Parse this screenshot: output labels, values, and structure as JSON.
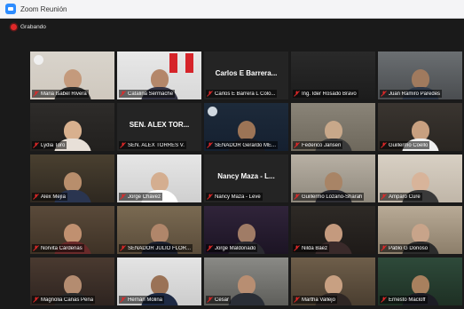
{
  "window": {
    "title": "Zoom Reunión"
  },
  "recording": {
    "label": "Grabando"
  },
  "colors": {
    "record": "#e02828",
    "accent": "#2d8cff",
    "active_border": "#c9d846",
    "mic_muted": "#e02828"
  },
  "participants": [
    {
      "name": "Maria Isabel Rivera"
    },
    {
      "name": "Catalina Sermache"
    },
    {
      "name": "Carlos E Barrera L Colo...",
      "display": "Carlos E Barrera..."
    },
    {
      "name": "Ing. Ider Rosado Bravo"
    },
    {
      "name": "Juan Ramiro Paredes"
    },
    {
      "name": "Lydia Toro"
    },
    {
      "name": "SEN. ALEX TORRES V.",
      "display": "SEN. ALEX TOR..."
    },
    {
      "name": "SENADOR Gerardo ME..."
    },
    {
      "name": "Federico Jansen"
    },
    {
      "name": "Guillermo Coello"
    },
    {
      "name": "Alex Mejía"
    },
    {
      "name": "Jorge Chavez"
    },
    {
      "name": "Nancy Maza - Leve",
      "display": "Nancy Maza - L..."
    },
    {
      "name": "Guillermo Lozano-Sharah"
    },
    {
      "name": "Amparo Cure"
    },
    {
      "name": "Norvita Cárdenas"
    },
    {
      "name": "SENADOR JULIO FLOR..."
    },
    {
      "name": "Jorge Maldonado"
    },
    {
      "name": "Nilda Báez"
    },
    {
      "name": "Pablo G Donoso"
    },
    {
      "name": "Magnolia Cañas Peña"
    },
    {
      "name": "Hernán Molina"
    },
    {
      "name": "Cesar"
    },
    {
      "name": "Martha Vallejo"
    },
    {
      "name": "Ernesto Macloff"
    }
  ]
}
